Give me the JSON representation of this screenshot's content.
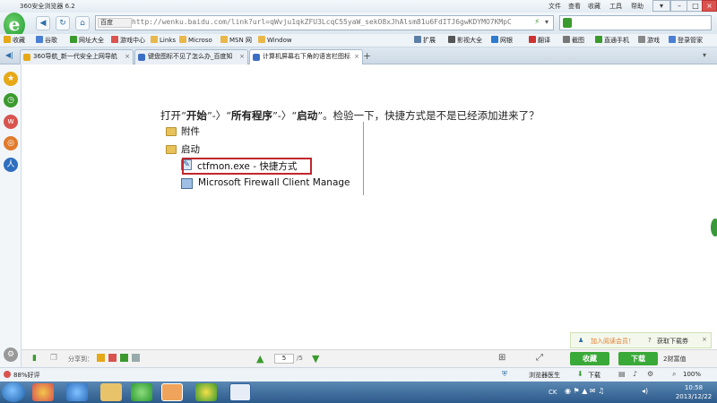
{
  "window": {
    "title": "360安全浏览器 6.2",
    "menu": [
      "文件",
      "查看",
      "收藏",
      "工具",
      "帮助"
    ]
  },
  "navbar": {
    "search_engine_badge": "百度",
    "url": "http://wenku.baidu.com/link?url=qWvju1qkZFU3LcqC55yaW_sekO8xJhAlsm81u6FdITJ6gwKDYMO7KMpC"
  },
  "favorites": {
    "items": [
      "收藏",
      "谷歌",
      "网址大全",
      "游戏中心",
      "Links",
      "Microso",
      "MSN 网",
      "Window"
    ],
    "right_items": [
      "扩展",
      "影视大全",
      "网银",
      "翻译",
      "截图",
      "直通手机",
      "游戏",
      "登录管家"
    ]
  },
  "tabs": [
    {
      "label": "360导航_新一代安全上网导航"
    },
    {
      "label": "键盘图标不见了怎么办_百度知"
    },
    {
      "label": "计算机屏幕右下角的语言栏图标"
    }
  ],
  "content": {
    "para_prefix": "打开“",
    "kw1": "开始",
    "arrow1": "”-〉“",
    "kw2": "所有程序",
    "arrow2": "”-〉“",
    "kw3": "启动",
    "para_suffix": "”。检验一下，快捷方式是不是已经添加进来了？",
    "menu_rows": [
      "附件",
      "启动",
      "ctfmon.exe - 快捷方式",
      "Microsoft Firewall Client Manage"
    ]
  },
  "bottombar": {
    "share_label": "分享到：",
    "page_current": "5",
    "page_total": "/5",
    "read_notice_link": "加入阅读会员！",
    "read_notice_help": "获取下载券",
    "collect_label": "收藏",
    "download_label": "下载",
    "download_cost": "2财富值"
  },
  "statusbar": {
    "left_text": "88%好评",
    "doctor": "浏览器医生",
    "download": "下载",
    "zoom": "100%"
  },
  "taskbar": {
    "ime": "CK",
    "time": "10:58",
    "date": "2013/12/22"
  }
}
